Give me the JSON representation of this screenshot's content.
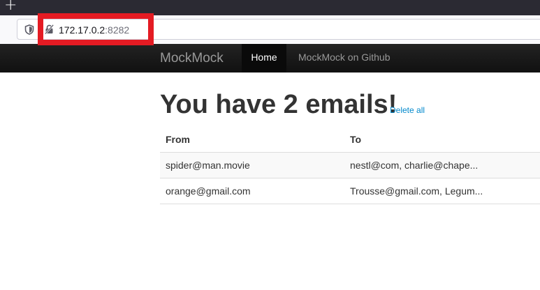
{
  "browser": {
    "new_tab_icon": "plus-icon",
    "tracking_icon": "shield-icon",
    "security_icon": "insecure-lock-icon",
    "url_host": "172.17.0.2",
    "url_port": ":8282",
    "highlight_color": "#e41b23"
  },
  "navbar": {
    "brand": "MockMock",
    "items": [
      {
        "label": "Home",
        "active": true
      },
      {
        "label": "MockMock on Github",
        "active": false
      }
    ]
  },
  "main": {
    "heading": "You have 2 emails!",
    "delete_all": "Delete all",
    "table": {
      "headers": [
        "From",
        "To"
      ],
      "rows": [
        {
          "from": "spider@man.movie",
          "to": "nestl@com, charlie@chape..."
        },
        {
          "from": "orange@gmail.com",
          "to": "Trousse@gmail.com, Legum..."
        }
      ]
    }
  },
  "colors": {
    "navbar_bg": "#1b1b1b",
    "link": "#0088cc",
    "text": "#333333"
  }
}
